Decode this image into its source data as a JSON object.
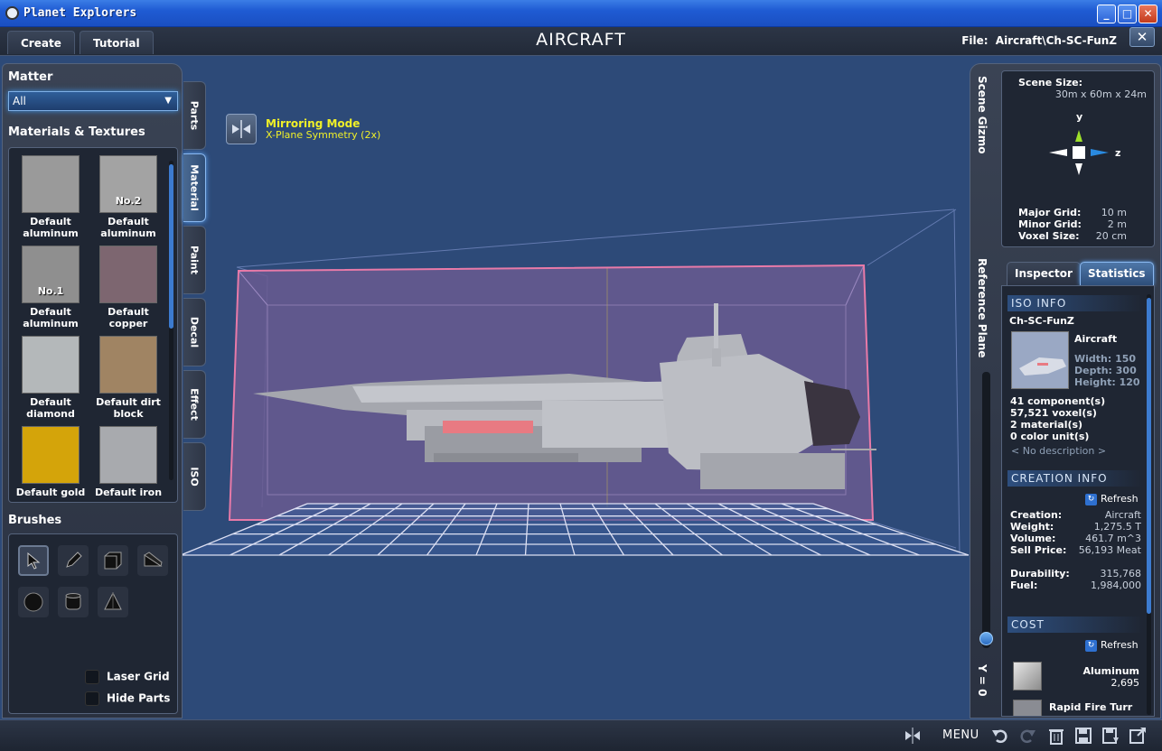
{
  "window": {
    "title": "Planet Explorers",
    "minimize": "_",
    "maximize": "□",
    "close": "✕"
  },
  "topbar": {
    "create_label": "Create",
    "tutorial_label": "Tutorial",
    "app_title": "AIRCRAFT",
    "file_label": "File:",
    "file_path": "Aircraft\\Ch-SC-FunZ",
    "exit_label": "✕"
  },
  "left": {
    "matter_title": "Matter",
    "matter_selected": "All",
    "materials_title": "Materials & Textures",
    "materials": [
      {
        "label": "Default aluminum",
        "tag": "",
        "color": "#9a9a9a"
      },
      {
        "label": "Default aluminum",
        "tag": "No.2",
        "color": "#a3a3a3"
      },
      {
        "label": "Default aluminum",
        "tag": "No.1",
        "color": "#8f8f8f"
      },
      {
        "label": "Default copper",
        "tag": "",
        "color": "#7d6670"
      },
      {
        "label": "Default diamond",
        "tag": "",
        "color": "#b4b8ba"
      },
      {
        "label": "Default dirt block",
        "tag": "",
        "color": "#a08463"
      },
      {
        "label": "Default gold",
        "tag": "",
        "color": "#d4a40a"
      },
      {
        "label": "Default iron",
        "tag": "",
        "color": "#a8aaae"
      }
    ],
    "brushes_title": "Brushes",
    "laser_grid": "Laser Grid",
    "hide_parts": "Hide Parts"
  },
  "tabs": {
    "parts": "Parts",
    "material": "Material",
    "paint": "Paint",
    "decal": "Decal",
    "effect": "Effect",
    "iso": "ISO"
  },
  "mirror": {
    "title": "Mirroring Mode",
    "subtitle": "X-Plane Symmetry (2x)"
  },
  "right": {
    "scene_gizmo": "Scene Gizmo",
    "reference_plane": "Reference Plane",
    "y_value": "Y = 0",
    "scene_size_label": "Scene Size:",
    "scene_size_value": "30m x 60m x 24m",
    "axis_y": "y",
    "axis_z": "z",
    "major_grid_label": "Major Grid:",
    "major_grid_value": "10 m",
    "minor_grid_label": "Minor Grid:",
    "minor_grid_value": "2 m",
    "voxel_size_label": "Voxel Size:",
    "voxel_size_value": "20 cm",
    "tab_inspector": "Inspector",
    "tab_statistics": "Statistics"
  },
  "stats": {
    "iso_info_title": "ISO INFO",
    "name": "Ch-SC-FunZ",
    "category": "Aircraft",
    "width": "Width: 150",
    "depth": "Depth: 300",
    "height": "Height: 120",
    "components": "41 component(s)",
    "voxels": "57,521 voxel(s)",
    "materials": "2 material(s)",
    "color_units": "0 color unit(s)",
    "description": "< No description >",
    "creation_info_title": "CREATION INFO",
    "refresh_label": "Refresh",
    "creation_label": "Creation:",
    "creation_value": "Aircraft",
    "weight_label": "Weight:",
    "weight_value": "1,275.5 T",
    "volume_label": "Volume:",
    "volume_value": "461.7 m^3",
    "sell_label": "Sell Price:",
    "sell_value": "56,193 Meat",
    "durability_label": "Durability:",
    "durability_value": "315,768",
    "fuel_label": "Fuel:",
    "fuel_value": "1,984,000",
    "cost_title": "COST",
    "cost_refresh": "Refresh",
    "cost_items": [
      {
        "name": "Aluminum",
        "qty": "2,695"
      },
      {
        "name": "Rapid Fire Turr",
        "qty": ""
      }
    ]
  },
  "bottom": {
    "menu_label": "MENU"
  },
  "colors": {
    "accent": "#3c7bd0",
    "mirror_text": "#f0f028",
    "bounds": "#e87aa8",
    "grid": "#f0f0ff"
  }
}
